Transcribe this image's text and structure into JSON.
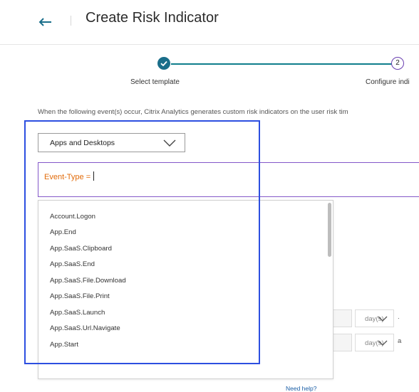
{
  "header": {
    "title": "Create Risk Indicator"
  },
  "stepper": {
    "steps": [
      {
        "number": "1",
        "label": "Select template",
        "state": "completed"
      },
      {
        "number": "2",
        "label": "Configure indi",
        "state": "active"
      }
    ]
  },
  "description": "When the following event(s) occur, Citrix Analytics generates custom risk indicators on the user risk tim",
  "datasource_select": {
    "value": "Apps and Desktops"
  },
  "query": {
    "text": "Event-Type = "
  },
  "event_options": [
    "Account.Logon",
    "App.End",
    "App.SaaS.Clipboard",
    "App.SaaS.End",
    "App.SaaS.File.Download",
    "App.SaaS.File.Print",
    "App.SaaS.Launch",
    "App.SaaS.Url.Navigate",
    "App.Start"
  ],
  "need_help": "Need help?",
  "rows": [
    {
      "unit": "day(s)",
      "suffix": "."
    },
    {
      "unit": "day(s)",
      "suffix": "a"
    }
  ],
  "colors": {
    "accent_teal": "#1a6e8a",
    "active_step": "#6a3fb0",
    "query_text": "#e26b0a",
    "highlight": "#2d4fe0"
  }
}
